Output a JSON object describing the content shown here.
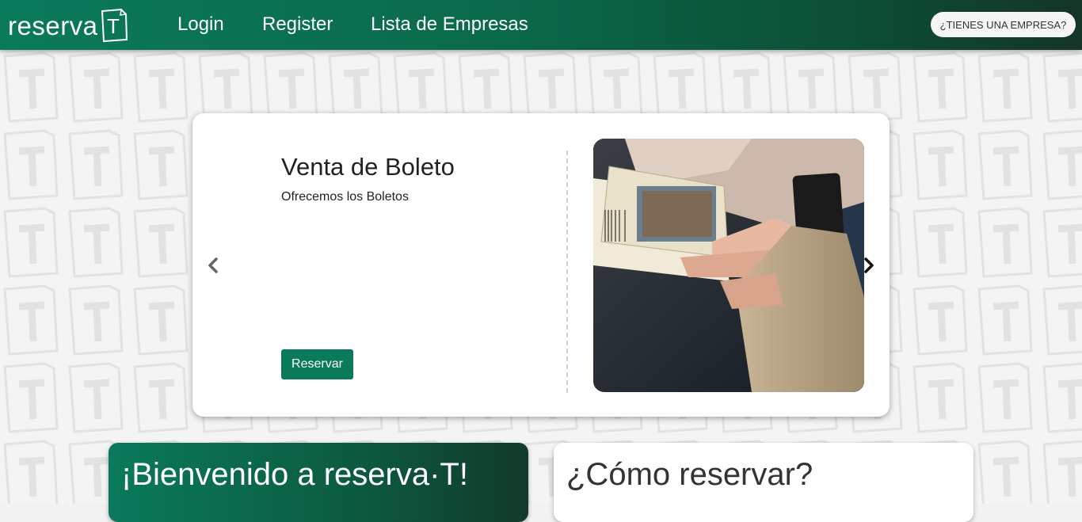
{
  "navbar": {
    "brand_text": "reserva",
    "brand_logo_letter": "T",
    "links": [
      "Login",
      "Register",
      "Lista de Empresas"
    ],
    "company_button_label": "¿TIENES UNA EMPRESA?",
    "gradient_start": "#0a7a5a",
    "gradient_end": "#153526"
  },
  "carousel": {
    "title": "Venta de Boleto",
    "description": "Ofrecemos los Boletos",
    "button_label": "Reservar",
    "prev_icon": "chevron-left-icon",
    "next_icon": "chevron-right-icon",
    "image_subject": "hand-holding-tickets-photo"
  },
  "sections": {
    "welcome_title": "¡Bienvenido a reserva·T!",
    "howto_title": "¿Cómo reservar?"
  },
  "colors": {
    "accent": "#0a7a5a",
    "card_background": "#ffffff",
    "page_background": "#f4f4f4"
  }
}
